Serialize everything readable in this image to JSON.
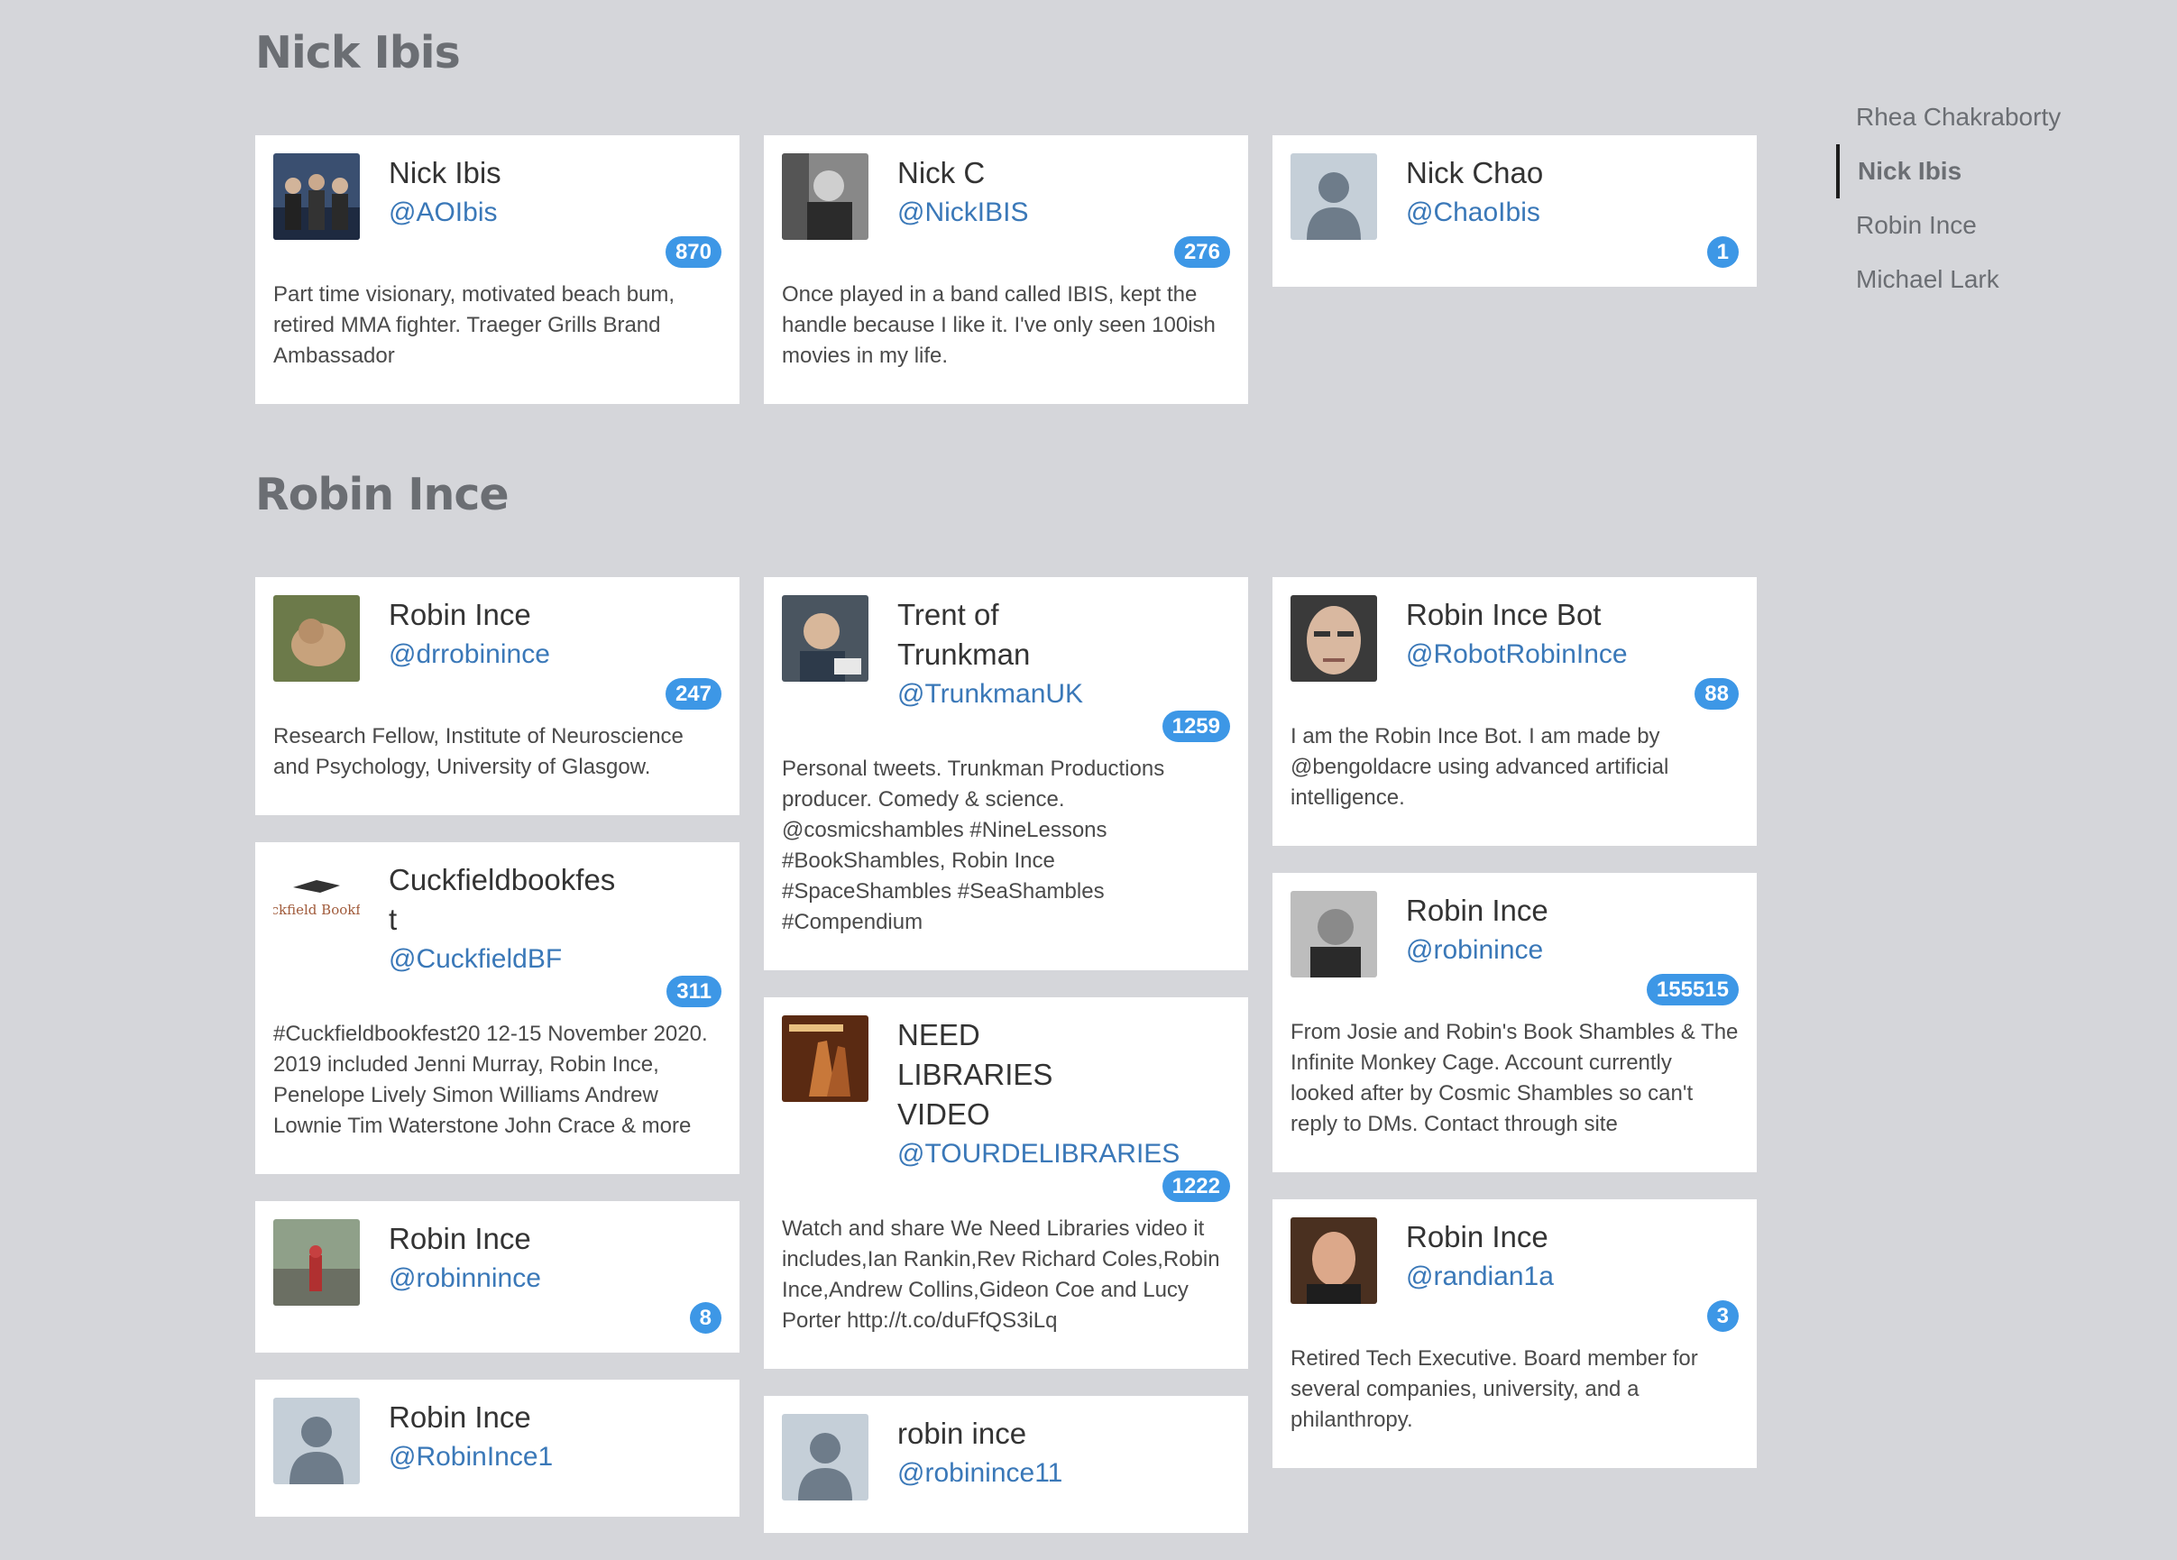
{
  "nav": {
    "items": [
      {
        "label": "Rhea Chakraborty",
        "active": false
      },
      {
        "label": "Nick Ibis",
        "active": true
      },
      {
        "label": "Robin Ince",
        "active": false
      },
      {
        "label": "Michael Lark",
        "active": false
      }
    ]
  },
  "sections": [
    {
      "title": "Nick Ibis",
      "columns": [
        [
          {
            "name": "Nick Ibis",
            "handle": "@AOIbis",
            "count": "870",
            "bio": "Part time visionary, motivated beach bum, retired MMA fighter. Traeger Grills Brand Ambassador",
            "avatar": "group-photo"
          }
        ],
        [
          {
            "name": "Nick C",
            "handle": "@NickIBIS",
            "count": "276",
            "bio": "Once played in a band called IBIS, kept the handle because I like it. I've only seen 100ish movies in my life.",
            "avatar": "bw-portrait"
          }
        ],
        [
          {
            "name": "Nick Chao",
            "handle": "@ChaoIbis",
            "count": "1",
            "bio": "",
            "avatar": "default"
          }
        ]
      ]
    },
    {
      "title": "Robin Ince",
      "columns": [
        [
          {
            "name": "Robin Ince",
            "handle": "@drrobinince",
            "count": "247",
            "bio": "Research Fellow, Institute of Neuroscience and Psychology, University of Glasgow.",
            "avatar": "dog-photo"
          },
          {
            "name": "Cuckfieldbookfest",
            "handle": "@CuckfieldBF",
            "count": "311",
            "bio": "#Cuckfieldbookfest20 12-15 November 2020. 2019 included Jenni Murray, Robin Ince, Penelope Lively Simon Williams Andrew Lownie Tim Waterstone John Crace & more",
            "avatar": "cuckfield-logo",
            "logo_text": "Cuckfield Bookfest"
          },
          {
            "name": "Robin Ince",
            "handle": "@robinnince",
            "count": "8",
            "bio": "",
            "avatar": "street-photo"
          },
          {
            "name": "Robin Ince",
            "handle": "@RobinInce1",
            "count": "",
            "bio": "",
            "avatar": "default"
          }
        ],
        [
          {
            "name": "Trent of Trunkman",
            "handle": "@TrunkmanUK",
            "count": "1259",
            "bio": "Personal tweets. Trunkman Productions producer. Comedy & science. @cosmicshambles #NineLessons #BookShambles, Robin Ince #SpaceShambles #SeaShambles #Compendium",
            "avatar": "man-photo"
          },
          {
            "name": "NEED LIBRARIES VIDEO",
            "handle": "@TOURDELIBRARIES",
            "count": "1222",
            "bio": "Watch and share We Need Libraries video it includes,Ian Rankin,Rev Richard Coles,Robin Ince,Andrew Collins,Gideon Coe and Lucy Porter http://t.co/duFfQS3iLq",
            "avatar": "library-photo"
          },
          {
            "name": "robin ince",
            "handle": "@robinince11",
            "count": "",
            "bio": "",
            "avatar": "default"
          }
        ],
        [
          {
            "name": "Robin Ince Bot",
            "handle": "@RobotRobinInce",
            "count": "88",
            "bio": "I am the Robin Ince Bot. I am made by @bengoldacre using advanced artificial intelligence.",
            "avatar": "face-closeup"
          },
          {
            "name": "Robin Ince",
            "handle": "@robinince",
            "count": "155515",
            "bio": "From Josie and Robin's Book Shambles & The Infinite Monkey Cage. Account currently looked after by Cosmic Shambles so can't reply to DMs. Contact through site",
            "avatar": "bw-man"
          },
          {
            "name": "Robin Ince",
            "handle": "@randian1a",
            "count": "3",
            "bio": "Retired Tech Executive. Board member for several companies, university, and a philanthropy.",
            "avatar": "smiling-man"
          }
        ]
      ]
    }
  ]
}
